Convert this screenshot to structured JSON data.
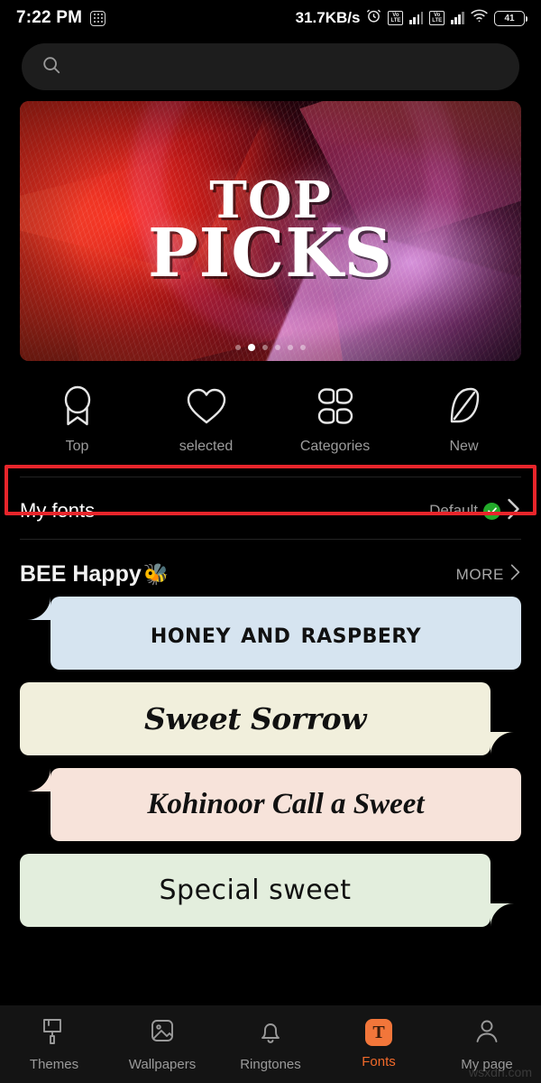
{
  "statusbar": {
    "time": "7:22 PM",
    "keypad_icon": "keypad-icon",
    "network_speed": "31.7KB/s",
    "alarm_icon": "alarm-icon",
    "volte1_label": "VoLTE",
    "volte2_label": "VoLTE",
    "wifi_icon": "wifi-icon",
    "battery_level": "41"
  },
  "search": {
    "icon": "search-icon",
    "value": "",
    "placeholder": ""
  },
  "banner": {
    "title_line1": "TOP",
    "title_line2": "PICKS",
    "dots_total": 6,
    "active_dot": 2
  },
  "quicknav": {
    "items": [
      {
        "label": "Top",
        "icon": "ribbon-icon"
      },
      {
        "label": "selected",
        "icon": "heart-icon"
      },
      {
        "label": "Categories",
        "icon": "grid-flower-icon"
      },
      {
        "label": "New",
        "icon": "leaf-icon"
      }
    ]
  },
  "myfonts": {
    "title": "My fonts",
    "value": "Default",
    "check_icon": "check-circle-icon",
    "chevron_icon": "chevron-right-icon",
    "highlight_color": "#e8252b"
  },
  "section": {
    "title": "BEE Happy",
    "emoji": "🐝",
    "more_label": "MORE",
    "more_icon": "chevron-right-icon"
  },
  "font_cards": [
    {
      "text": "Honey and Raspbery",
      "bg": "#d6e4f0",
      "tail": "top-left"
    },
    {
      "text": "Sweet Sorrow",
      "bg": "#f1efdc",
      "tail": "bottom-right"
    },
    {
      "text": "Kohinoor  Call a Sweet",
      "bg": "#f7e3da",
      "tail": "top-left"
    },
    {
      "text": "Special sweet",
      "bg": "#e3eedd",
      "tail": "bottom-right"
    }
  ],
  "bottomnav": {
    "active_color": "#f26a2a",
    "items": [
      {
        "label": "Themes",
        "icon": "paint-roller-icon",
        "active": false
      },
      {
        "label": "Wallpapers",
        "icon": "image-icon",
        "active": false
      },
      {
        "label": "Ringtones",
        "icon": "bell-icon",
        "active": false
      },
      {
        "label": "Fonts",
        "icon": "fonts-t-icon",
        "active": true
      },
      {
        "label": "My page",
        "icon": "person-icon",
        "active": false
      }
    ]
  },
  "watermark": {
    "text": "wsxdn.com"
  }
}
